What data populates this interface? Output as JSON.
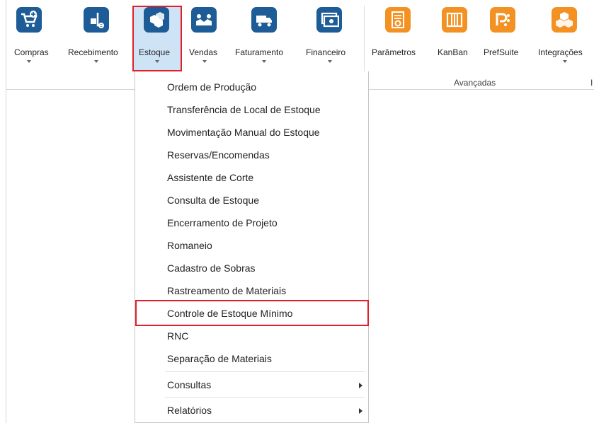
{
  "ribbon": {
    "buttons": [
      {
        "label": "Compras",
        "icon": "cart-plus-icon"
      },
      {
        "label": "Recebimento",
        "icon": "hand-truck-icon"
      },
      {
        "label": "Estoque",
        "icon": "boxes-icon"
      },
      {
        "label": "Vendas",
        "icon": "handshake-icon"
      },
      {
        "label": "Faturamento",
        "icon": "truck-icon"
      },
      {
        "label": "Financeiro",
        "icon": "money-icon"
      },
      {
        "label": "Parâmetros",
        "icon": "settings-doc-icon"
      },
      {
        "label": "KanBan",
        "icon": "kanban-icon"
      },
      {
        "label": "PrefSuite",
        "icon": "prefsuite-icon"
      },
      {
        "label": "Integrações",
        "icon": "integration-boxes-icon"
      }
    ],
    "group_label": "Avançadas",
    "group_label_partial": "I",
    "colors": {
      "module_icon": "#1d5c96",
      "advanced_icon": "#f39223",
      "highlight": "#e02028",
      "active_bg": "#cfe3f7"
    }
  },
  "menu": {
    "items": [
      "Ordem de Produção",
      "Transferência de Local de Estoque",
      "Movimentação Manual do Estoque",
      "Reservas/Encomendas",
      "Assistente de Corte",
      "Consulta de Estoque",
      "Encerramento de Projeto",
      "Romaneio",
      "Cadastro de Sobras",
      "Rastreamento de Materiais",
      "Controle de Estoque Mínimo",
      "RNC",
      "Separação de Materiais"
    ],
    "submenus": [
      "Consultas",
      "Relatórios"
    ]
  }
}
